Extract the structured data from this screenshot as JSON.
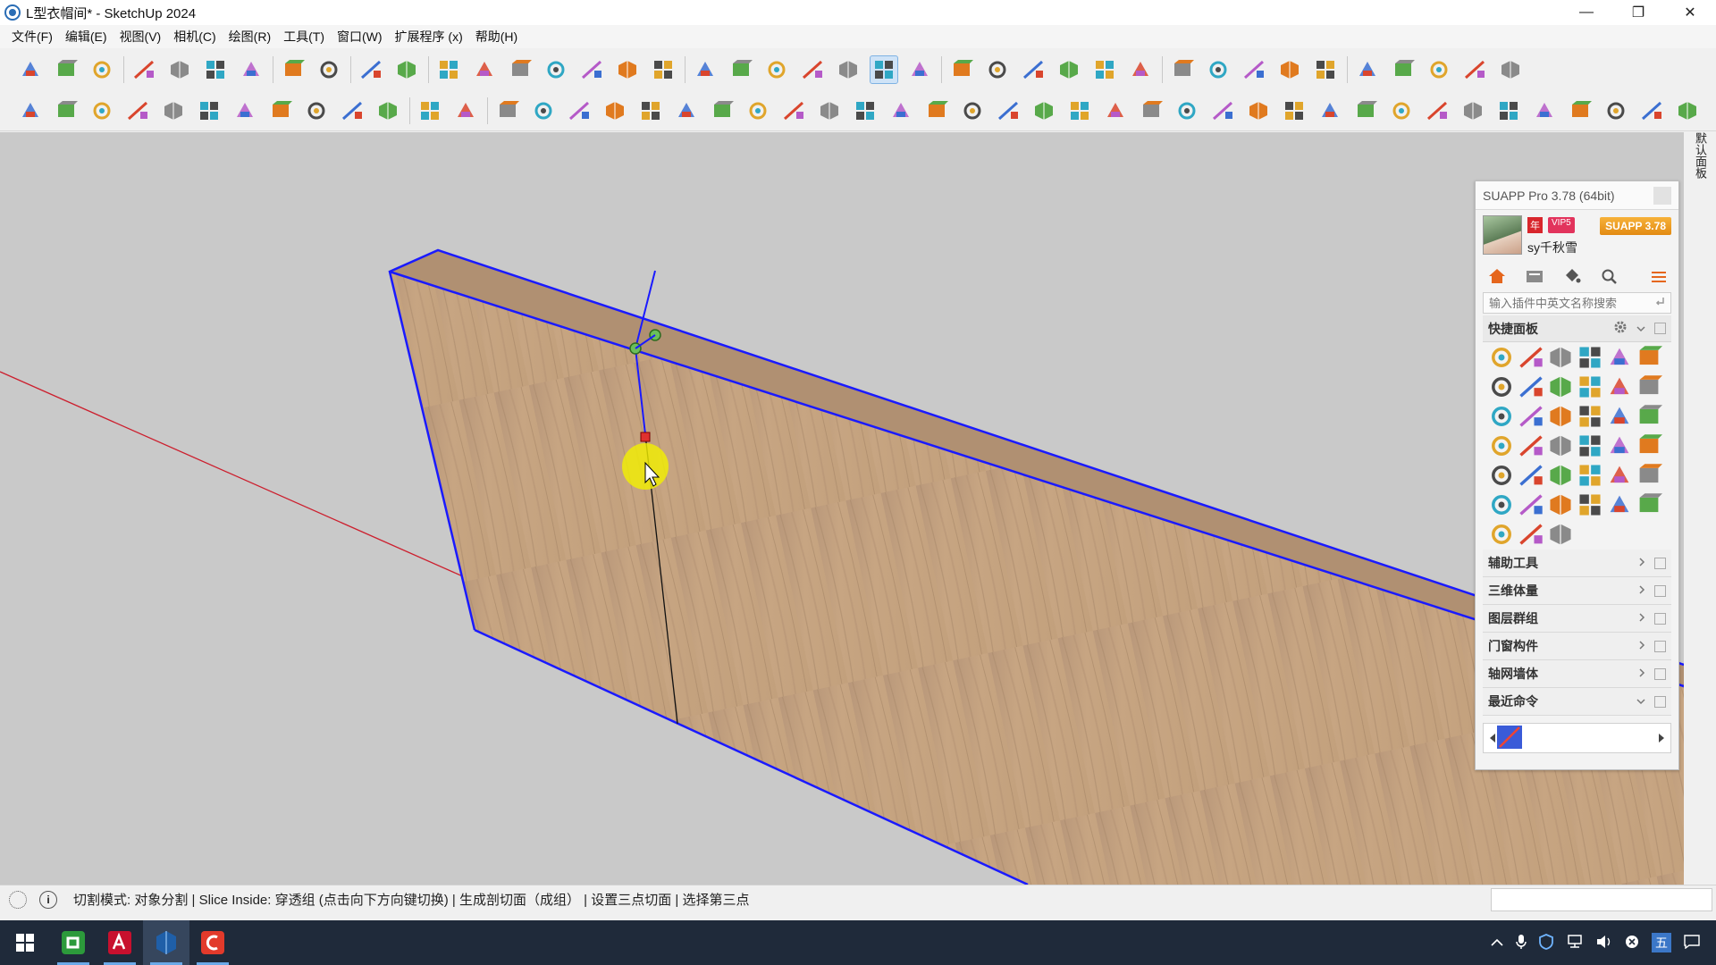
{
  "window": {
    "title": "L型衣帽间* - SketchUp 2024",
    "minimize_glyph": "—",
    "restore_glyph": "❐",
    "close_glyph": "✕"
  },
  "menu": [
    "文件(F)",
    "编辑(E)",
    "视图(V)",
    "相机(C)",
    "绘图(R)",
    "工具(T)",
    "窗口(W)",
    "扩展程序 (x)",
    "帮助(H)"
  ],
  "toolbar_row1_icons": [
    "new-file-icon",
    "open-folder-icon",
    "save-icon",
    "cut-icon",
    "copy-icon",
    "paste-icon",
    "delete-icon",
    "undo-icon",
    "redo-icon",
    "print-icon",
    "model-info-icon",
    "iso-view-icon",
    "top-view-icon",
    "front-view-icon",
    "right-view-icon",
    "back-view-icon",
    "left-view-icon",
    "bottom-view-icon",
    "xray-icon",
    "back-edges-icon",
    "wireframe-icon",
    "hidden-line-icon",
    "shaded-icon",
    "shaded-textures-icon",
    "monochrome-icon",
    "component-icon",
    "components-browser-icon",
    "warehouse-icon",
    "extension-warehouse-icon",
    "send-to-layout-icon",
    "sandbox-icon",
    "add-location-icon",
    "geo-icon",
    "photo-match-icon",
    "grid-icon",
    "cloud-icon",
    "settings-icon",
    "scenes-icon",
    "info-icon",
    "cart-icon",
    "account-icon"
  ],
  "toolbar_row2_icons": [
    "line-icon",
    "dimension-icon",
    "follow-me-icon",
    "eraser-icon",
    "push-pull-icon",
    "offset-icon",
    "rotate-icon",
    "scale-icon",
    "tape-icon",
    "cut-line-icon",
    "slice-icon",
    "axis-icon",
    "section-icon",
    "plane-blue-icon",
    "plane-light-blue-icon",
    "plane-yellow-icon",
    "plane-green-icon",
    "plane-red-icon",
    "plane-white-icon",
    "rotate-orange-icon",
    "red-square-icon",
    "stripes-icon",
    "flag-icon",
    "box-icon",
    "link-icon",
    "arc-icon",
    "curve-icon",
    "cross-red-icon",
    "cross-green-icon",
    "cross-blue-icon",
    "cone-icon",
    "cone-green-icon",
    "triangle-icon",
    "hook-icon",
    "spiral-icon",
    "loop-icon",
    "move-cross-icon",
    "bucket-icon",
    "u-turn-icon",
    "stack-icon",
    "extrude-icon",
    "cube-red-icon",
    "cube-multi-icon",
    "diamond-icon",
    "grid-multi-icon",
    "window-icon",
    "texture-icon"
  ],
  "viewport": {
    "background": "#c9c9c9",
    "board_colors": [
      "#c4a27f",
      "#a98a6a"
    ],
    "edge_color": "#1a1aff",
    "axis_color": "#cc1f2e"
  },
  "tray_label": "默认面板",
  "suapp": {
    "title": "SUAPP Pro 3.78 (64bit)",
    "badge_year": "年",
    "badge_vip": "VIP5",
    "badge_version": "SUAPP 3.78",
    "username": "sy千秋雪",
    "search_placeholder": "输入插件中英文名称搜索",
    "quick_panel_label": "快捷面板",
    "quick_icons": [
      "bezier-icon",
      "scroll-icon",
      "stack-cake-icon",
      "pencil-icon",
      "polygon-icon",
      "arrow-red-up-icon",
      "triangle-frame-icon",
      "shell-icon",
      "skin-icon",
      "arrow-green-up-icon",
      "arc-loop-icon",
      "color-gradient-icon",
      "plane-up-icon",
      "building-icon",
      "scissors-icon",
      "red-curve-icon",
      "wave-icon",
      "wave2-icon",
      "line-dash-icon",
      "wavy-blue-icon",
      "bend-icon",
      "cube-yellow-icon",
      "gear-shape-icon",
      "cylinder-icon",
      "pipe-icon",
      "stairs-icon",
      "brick-icon",
      "crate-icon",
      "box-orange-icon",
      "case-icon",
      "dish-icon",
      "grid-pattern-icon",
      "window-frame-icon",
      "box-open-icon",
      "slope-icon",
      "dotted-box-icon",
      "cyan-spiral-icon",
      "chart-icon",
      "slash-icon"
    ],
    "categories": [
      "辅助工具",
      "三维体量",
      "图层群组",
      "门窗构件",
      "轴网墙体",
      "最近命令"
    ]
  },
  "statusbar": {
    "text": "切割模式: 对象分割 | Slice  Inside: 穿透组 (点击向下方向键切换) | 生成剖切面（成组） | 设置三点切面 | 选择第三点",
    "info_glyph": "i"
  },
  "taskbar": {
    "apps": [
      "windows-start-icon",
      "camtasia-icon",
      "autocad-icon",
      "sketchup-icon",
      "recorder-icon"
    ],
    "tray_ime": "五"
  }
}
